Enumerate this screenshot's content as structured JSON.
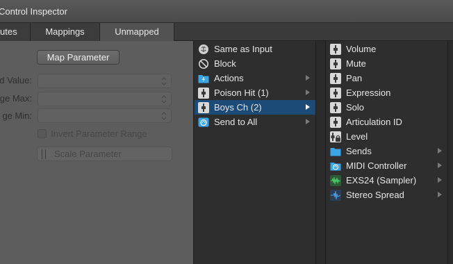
{
  "window": {
    "title": "Control Inspector"
  },
  "tabs": [
    {
      "label": "utes",
      "active": false
    },
    {
      "label": "Mappings",
      "active": false
    },
    {
      "label": "Unmapped",
      "active": true
    }
  ],
  "mapping_panel": {
    "map_button": "Map Parameter",
    "fields": [
      {
        "label": "d Value:",
        "value": ""
      },
      {
        "label": "ge Max:",
        "value": ""
      },
      {
        "label": "ge Min:",
        "value": ""
      }
    ],
    "invert_checkbox": {
      "label": "Invert Parameter Range",
      "checked": false
    },
    "scale_button": "Scale Parameter"
  },
  "column_1": {
    "items": [
      {
        "label": "Same as Input",
        "icon": "brain-icon",
        "submenu": false
      },
      {
        "label": "Block",
        "icon": "block-icon",
        "submenu": false
      },
      {
        "label": "Actions",
        "icon": "actions-folder-icon",
        "submenu": true
      },
      {
        "label": "Poison Hit (1)",
        "icon": "channel-strip-icon",
        "submenu": true
      },
      {
        "label": "Boys Ch (2)",
        "icon": "channel-strip-icon",
        "submenu": true,
        "selected": true
      },
      {
        "label": "Send to All",
        "icon": "send-to-all-icon",
        "submenu": true
      }
    ]
  },
  "column_2": {
    "items": [
      {
        "label": "Volume",
        "icon": "fader-icon",
        "submenu": false
      },
      {
        "label": "Mute",
        "icon": "fader-icon",
        "submenu": false
      },
      {
        "label": "Pan",
        "icon": "fader-icon",
        "submenu": false
      },
      {
        "label": "Expression",
        "icon": "fader-icon",
        "submenu": false
      },
      {
        "label": "Solo",
        "icon": "fader-icon",
        "submenu": false
      },
      {
        "label": "Articulation ID",
        "icon": "fader-icon",
        "submenu": false
      },
      {
        "label": "Level",
        "icon": "locked-fader-icon",
        "submenu": false
      },
      {
        "label": "Sends",
        "icon": "folder-icon",
        "submenu": true
      },
      {
        "label": "MIDI Controller",
        "icon": "midi-folder-icon",
        "submenu": true
      },
      {
        "label": "EXS24  (Sampler)",
        "icon": "waveform-icon",
        "submenu": true
      },
      {
        "label": "Stereo Spread",
        "icon": "stereo-spread-icon",
        "submenu": true
      }
    ]
  },
  "colors": {
    "selection": "#1c4b78",
    "folder_blue": "#3aa6e8",
    "list_background": "#2e2e2e",
    "inspector_background": "#5d5d5d"
  }
}
